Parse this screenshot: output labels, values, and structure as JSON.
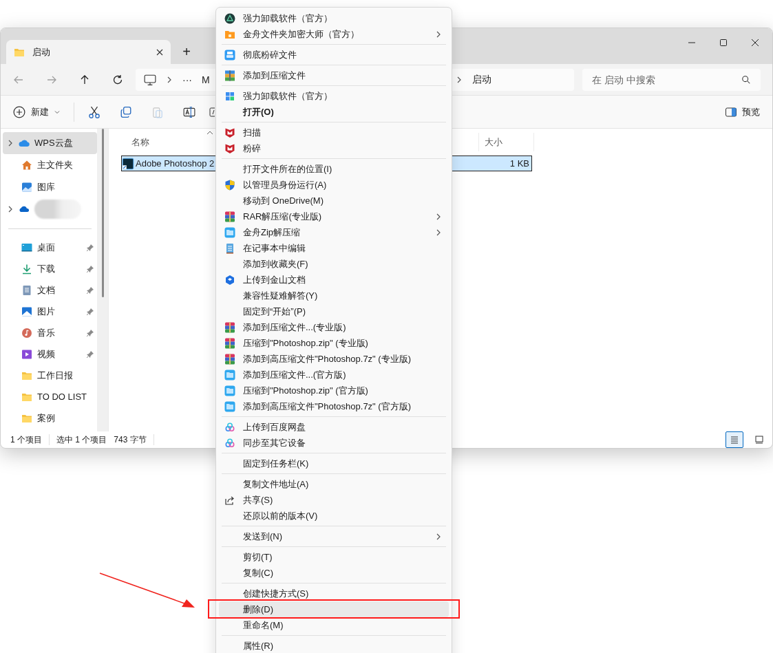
{
  "tabs": [
    {
      "label": "启动",
      "selected": true,
      "closable": true
    }
  ],
  "new_tab": "+",
  "nav": {
    "buttons": [
      {
        "disabled": true
      },
      {
        "disabled": true
      },
      {
        "disabled": false
      },
      {
        "disabled": false
      }
    ]
  },
  "address": {
    "overflow": "···",
    "segments": [
      "M",
      "启动"
    ]
  },
  "search": {
    "placeholder": "在 启动 中搜索"
  },
  "commands": [
    {
      "label": "新建",
      "dropdown": true,
      "disabled": false
    },
    {
      "disabled": false
    },
    {
      "disabled": false
    },
    {
      "disabled": true
    },
    {
      "disabled": false
    },
    {
      "disabled": false
    }
  ],
  "preview_button": "预览",
  "sidebar": {
    "items": [
      {
        "kind": "item",
        "label": "WPS云盘",
        "expandable": true,
        "selected": true,
        "pinned": false
      },
      {
        "kind": "item",
        "label": "主文件夹",
        "expandable": false,
        "selected": false,
        "pinned": false
      },
      {
        "kind": "item",
        "label": "图库",
        "expandable": false,
        "selected": false,
        "pinned": false
      },
      {
        "kind": "item",
        "expandable": true,
        "selected": false,
        "pinned": false
      },
      {
        "kind": "divider"
      },
      {
        "kind": "item",
        "label": "桌面",
        "expandable": false,
        "selected": false,
        "pinned": true
      },
      {
        "kind": "item",
        "label": "下载",
        "expandable": false,
        "selected": false,
        "pinned": true
      },
      {
        "kind": "item",
        "label": "文档",
        "expandable": false,
        "selected": false,
        "pinned": true
      },
      {
        "kind": "item",
        "label": "图片",
        "expandable": false,
        "selected": false,
        "pinned": true
      },
      {
        "kind": "item",
        "label": "音乐",
        "expandable": false,
        "selected": false,
        "pinned": true
      },
      {
        "kind": "item",
        "label": "视频",
        "expandable": false,
        "selected": false,
        "pinned": true
      },
      {
        "kind": "item",
        "label": "工作日报",
        "expandable": false,
        "selected": false,
        "pinned": false
      },
      {
        "kind": "item",
        "label": "TO DO LIST",
        "expandable": false,
        "selected": false,
        "pinned": false
      },
      {
        "kind": "item",
        "label": "案例",
        "expandable": false,
        "selected": false,
        "pinned": false
      }
    ]
  },
  "table": {
    "columns": [
      {
        "label": "名称",
        "sorted": true
      },
      {
        "label": "大小"
      }
    ],
    "rows": [
      {
        "name": "Adobe Photoshop 2",
        "size": "1 KB",
        "selected": true
      }
    ]
  },
  "status_bar": {
    "items": [
      "1 个项目",
      "选中 1 个项目",
      "743 字节"
    ],
    "views": [
      {
        "selected": true
      },
      {
        "selected": false
      }
    ]
  },
  "context_menu": {
    "items": [
      {
        "kind": "item",
        "label": "强力卸载软件（官方）",
        "bold": false,
        "submenu": false,
        "selected": false
      },
      {
        "kind": "item",
        "label": "金舟文件夹加密大师（官方）",
        "bold": false,
        "submenu": true,
        "selected": false
      },
      {
        "kind": "separator"
      },
      {
        "kind": "item",
        "label": "彻底粉碎文件",
        "bold": false,
        "submenu": false,
        "selected": false
      },
      {
        "kind": "separator"
      },
      {
        "kind": "item",
        "label": "添加到压缩文件",
        "bold": false,
        "submenu": false,
        "selected": false
      },
      {
        "kind": "separator"
      },
      {
        "kind": "item",
        "label": "强力卸载软件（官方）",
        "bold": false,
        "submenu": false,
        "selected": false
      },
      {
        "kind": "item",
        "label": "打开(O)",
        "bold": true,
        "submenu": false,
        "selected": false
      },
      {
        "kind": "separator"
      },
      {
        "kind": "item",
        "label": "扫描",
        "bold": false,
        "submenu": false,
        "selected": false
      },
      {
        "kind": "item",
        "label": "粉碎",
        "bold": false,
        "submenu": false,
        "selected": false
      },
      {
        "kind": "separator"
      },
      {
        "kind": "item",
        "label": "打开文件所在的位置(I)",
        "bold": false,
        "submenu": false,
        "selected": false
      },
      {
        "kind": "item",
        "label": "以管理员身份运行(A)",
        "bold": false,
        "submenu": false,
        "selected": false
      },
      {
        "kind": "item",
        "label": "移动到 OneDrive(M)",
        "bold": false,
        "submenu": false,
        "selected": false
      },
      {
        "kind": "item",
        "label": "RAR解压缩(专业版)",
        "bold": false,
        "submenu": true,
        "selected": false
      },
      {
        "kind": "item",
        "label": "金舟Zip解压缩",
        "bold": false,
        "submenu": true,
        "selected": false
      },
      {
        "kind": "item",
        "label": "在记事本中编辑",
        "bold": false,
        "submenu": false,
        "selected": false
      },
      {
        "kind": "item",
        "label": "添加到收藏夹(F)",
        "bold": false,
        "submenu": false,
        "selected": false
      },
      {
        "kind": "item",
        "label": "上传到金山文档",
        "bold": false,
        "submenu": false,
        "selected": false
      },
      {
        "kind": "item",
        "label": "兼容性疑难解答(Y)",
        "bold": false,
        "submenu": false,
        "selected": false
      },
      {
        "kind": "item",
        "label": "固定到“开始”(P)",
        "bold": false,
        "submenu": false,
        "selected": false
      },
      {
        "kind": "item",
        "label": "添加到压缩文件...(专业版)",
        "bold": false,
        "submenu": false,
        "selected": false
      },
      {
        "kind": "item",
        "label": "压缩到\"Photoshop.zip\" (专业版)",
        "bold": false,
        "submenu": false,
        "selected": false
      },
      {
        "kind": "item",
        "label": "添加到高压缩文件\"Photoshop.7z\" (专业版)",
        "bold": false,
        "submenu": false,
        "selected": false
      },
      {
        "kind": "item",
        "label": "添加到压缩文件...(官方版)",
        "bold": false,
        "submenu": false,
        "selected": false
      },
      {
        "kind": "item",
        "label": "压缩到\"Photoshop.zip\" (官方版)",
        "bold": false,
        "submenu": false,
        "selected": false
      },
      {
        "kind": "item",
        "label": "添加到高压缩文件\"Photoshop.7z\" (官方版)",
        "bold": false,
        "submenu": false,
        "selected": false
      },
      {
        "kind": "separator"
      },
      {
        "kind": "item",
        "label": "上传到百度网盘",
        "bold": false,
        "submenu": false,
        "selected": false
      },
      {
        "kind": "item",
        "label": "同步至其它设备",
        "bold": false,
        "submenu": false,
        "selected": false
      },
      {
        "kind": "separator"
      },
      {
        "kind": "item",
        "label": "固定到任务栏(K)",
        "bold": false,
        "submenu": false,
        "selected": false
      },
      {
        "kind": "separator"
      },
      {
        "kind": "item",
        "label": "复制文件地址(A)",
        "bold": false,
        "submenu": false,
        "selected": false
      },
      {
        "kind": "item",
        "label": "共享(S)",
        "bold": false,
        "submenu": false,
        "selected": false
      },
      {
        "kind": "item",
        "label": "还原以前的版本(V)",
        "bold": false,
        "submenu": false,
        "selected": false
      },
      {
        "kind": "separator"
      },
      {
        "kind": "item",
        "label": "发送到(N)",
        "bold": false,
        "submenu": true,
        "selected": false
      },
      {
        "kind": "separator"
      },
      {
        "kind": "item",
        "label": "剪切(T)",
        "bold": false,
        "submenu": false,
        "selected": false
      },
      {
        "kind": "item",
        "label": "复制(C)",
        "bold": false,
        "submenu": false,
        "selected": false
      },
      {
        "kind": "separator"
      },
      {
        "kind": "item",
        "label": "创建快捷方式(S)",
        "bold": false,
        "submenu": false,
        "selected": false
      },
      {
        "kind": "item",
        "label": "删除(D)",
        "bold": false,
        "submenu": false,
        "selected": true,
        "highlighted": true
      },
      {
        "kind": "item",
        "label": "重命名(M)",
        "bold": false,
        "submenu": false,
        "selected": false
      },
      {
        "kind": "separator"
      },
      {
        "kind": "item",
        "label": "属性(R)",
        "bold": false,
        "submenu": false,
        "selected": false
      }
    ]
  }
}
